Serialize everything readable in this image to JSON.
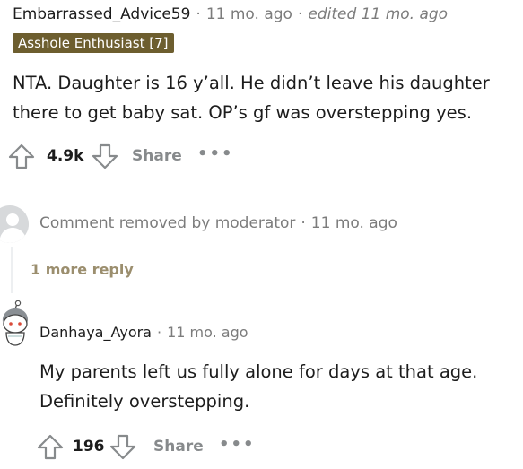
{
  "top_comment": {
    "author": "Embarrassed_Advice59",
    "separator": "·",
    "time": "11 mo. ago",
    "edited": "edited 11 mo. ago",
    "flair": "Asshole Enthusiast [7]",
    "body_line1": "NTA. Daughter is 16 y’all. He didn’t leave his daughter",
    "body_line2": "there to get baby sat. OP’s gf was overstepping yes.",
    "score": "4.9k",
    "share_label": "Share",
    "more_label": "•••"
  },
  "removed_comment": {
    "text": "Comment removed by moderator",
    "separator": "·",
    "time": "11 mo. ago",
    "more_reply_label": "1 more reply"
  },
  "reply_comment": {
    "author": "Danhaya_Ayora",
    "separator": "·",
    "time": "11 mo. ago",
    "body_line1": "My parents left us fully alone for days at that age.",
    "body_line2": "Definitely overstepping.",
    "score": "196",
    "share_label": "Share",
    "more_label": "•••"
  },
  "colors": {
    "text": "#1c1c1c",
    "muted": "#7c7c7c",
    "flair_bg": "#6d5e2f",
    "more_reply": "#9b8e6e",
    "action_gray": "#878a8c"
  }
}
